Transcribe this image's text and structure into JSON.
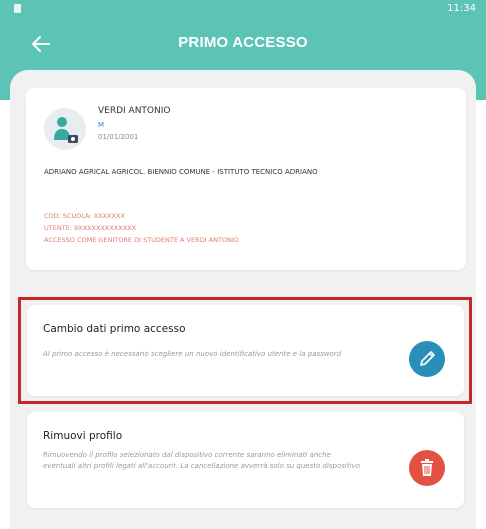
{
  "status_bar": {
    "time": "11:34"
  },
  "header": {
    "title": "PRIMO ACCESSO"
  },
  "profile": {
    "name": "VERDI ANTONIO",
    "badge": "M",
    "date": "01/01/2001",
    "school": "ADRIANO AGRICAL AGRICOL. BIENNIO COMUNE - ISTITUTO TECNICO ADRIANO",
    "meta_school_code": "COD. SCUOLA: XXXXXXX",
    "meta_user": "UTENTE: 9XXXXXXXXXXXXX",
    "meta_access": "ACCESSO COME GENITORE DI STUDENTE A VERDI ANTONIO"
  },
  "change_access": {
    "title": "Cambio dati primo accesso",
    "description": "Al primo accesso è necessario scegliere un nuovo identificativo utente e la password"
  },
  "remove_profile": {
    "title": "Rimuovi profilo",
    "description": "Rimuovendo il profilo selezionato dal dispositivo corrente saranno eliminati anche eventuali altri profili legati all'account. La cancellazione avverrà solo su questo dispositivo"
  },
  "colors": {
    "header": "#5cc4b4",
    "accent_edit": "#2a8fb8",
    "accent_delete": "#e25141",
    "highlight_border": "#c62828"
  },
  "icons": [
    "back-arrow-icon",
    "user-avatar-icon",
    "edit-pencil-icon",
    "trash-icon"
  ]
}
